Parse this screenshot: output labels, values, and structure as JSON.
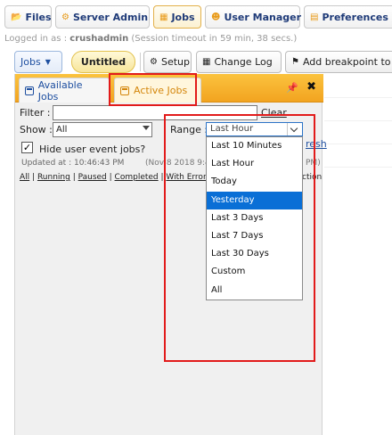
{
  "nav": {
    "files": "Files",
    "server_admin": "Server Admin",
    "jobs": "Jobs",
    "user_manager": "User Manager",
    "preferences": "Preferences"
  },
  "session": {
    "prefix": "Logged in as :",
    "user": "crushadmin",
    "timeout": "(Session timeout in 59 min, 38 secs.)"
  },
  "toolbar": {
    "jobs_label": "Jobs",
    "untitled_label": "Untitled",
    "setup_label": "Setup",
    "changelog_label": "Change Log",
    "breakpoint_label": "Add breakpoint to"
  },
  "panel": {
    "tab_available": "Available Jobs",
    "tab_active": "Active Jobs",
    "filter_label": "Filter :",
    "clear_label": "Clear",
    "show_label": "Show :",
    "show_value": "All",
    "range_label": "Range :",
    "range_value": "Last Hour",
    "refresh_fragment": "resh",
    "hide_user_events_label": "Hide user event jobs?",
    "hide_user_events_checked": true,
    "updated_label": "Updated at : 10:46:43 PM",
    "date_fragment": "(Nov 8 2018 9:4",
    "date_fragment_end": "PM)",
    "action_fragment": "ction",
    "status_links": [
      "All",
      "Running",
      "Paused",
      "Completed",
      "With Error",
      "S"
    ]
  },
  "range_options": [
    "Last 10 Minutes",
    "Last Hour",
    "Today",
    "Yesterday",
    "Last 3 Days",
    "Last 7 Days",
    "Last 30 Days",
    "Custom",
    "All"
  ],
  "range_highlighted": "Yesterday",
  "colors": {
    "accent_orange": "#f2a420",
    "link_blue": "#1e4fa0",
    "selection_blue": "#0a6fd6",
    "annotation_red": "#e21b1b"
  }
}
